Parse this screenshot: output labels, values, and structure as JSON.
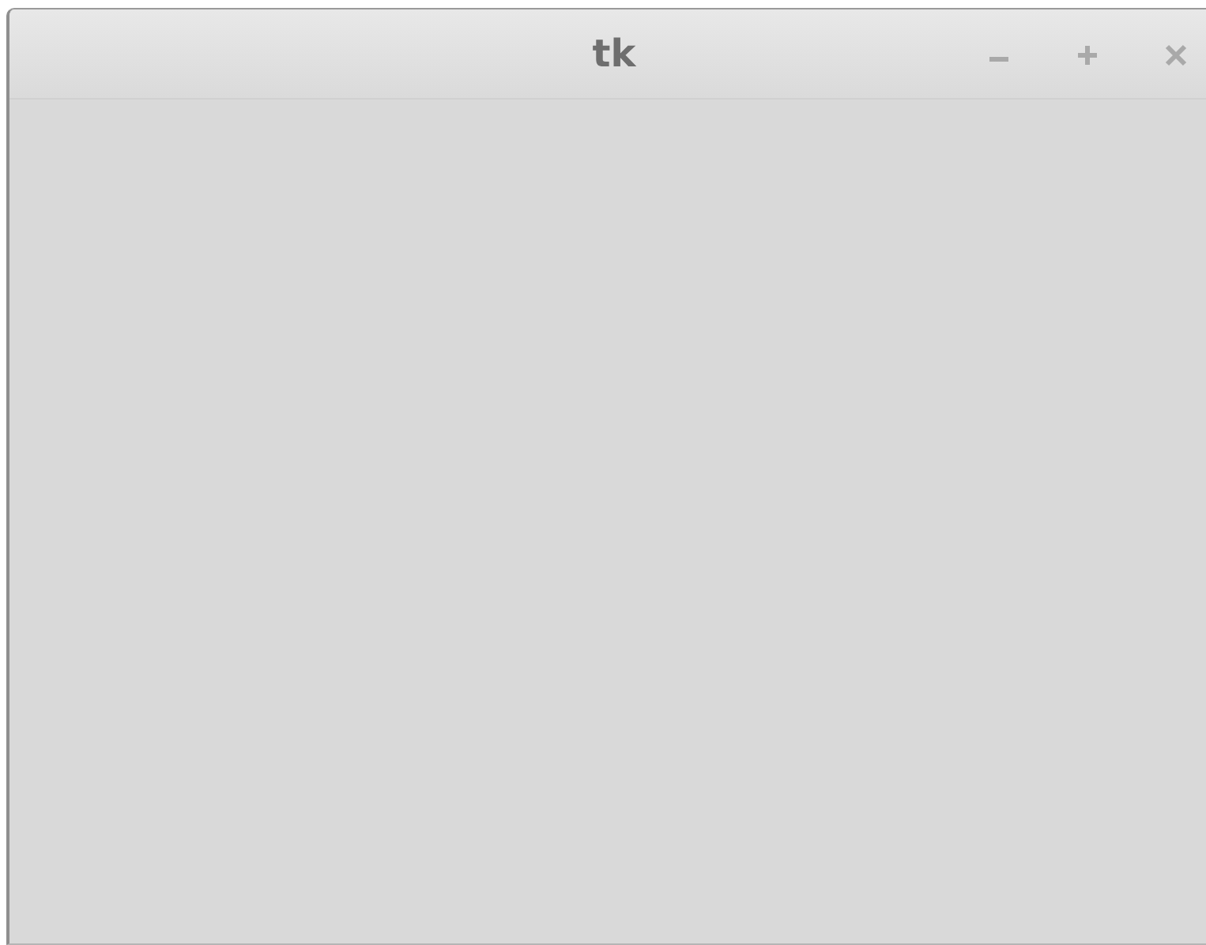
{
  "window": {
    "title": "tk"
  }
}
